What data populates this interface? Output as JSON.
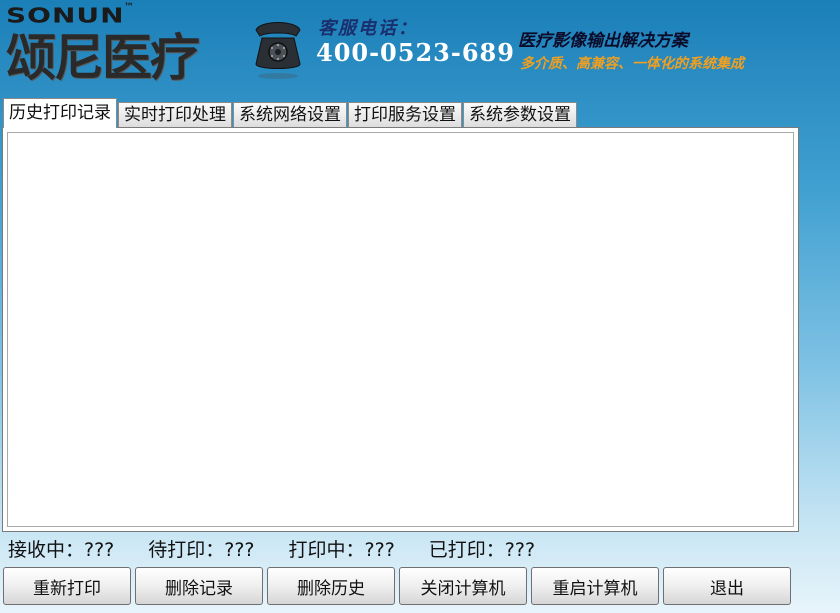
{
  "header": {
    "logo_en": "SONUN",
    "logo_tm": "™",
    "logo_cn": "颂尼医疗",
    "hotline_label": "客服电话：",
    "hotline_number": "400-0523-689",
    "slogan_main": "医疗影像输出解决方案",
    "slogan_sub": "多介质、高兼容、一体化的系统集成"
  },
  "tabs": [
    {
      "label": "历史打印记录",
      "active": true
    },
    {
      "label": "实时打印处理",
      "active": false
    },
    {
      "label": "系统网络设置",
      "active": false
    },
    {
      "label": "打印服务设置",
      "active": false
    },
    {
      "label": "系统参数设置",
      "active": false
    }
  ],
  "status": {
    "receiving": "接收中：???",
    "waiting": "待打印：???",
    "printing": "打印中：???",
    "printed": "已打印：???"
  },
  "buttons": {
    "reprint": "重新打印",
    "delete_record": "删除记录",
    "delete_history": "删除历史",
    "shutdown": "关闭计算机",
    "restart": "重启计算机",
    "exit": "退出"
  },
  "icons": {
    "phone": "phone-icon"
  },
  "colors": {
    "header_blue": "#1b7fb8",
    "hotline_label": "#1a2f6e",
    "slogan_sub": "#f0a020"
  }
}
